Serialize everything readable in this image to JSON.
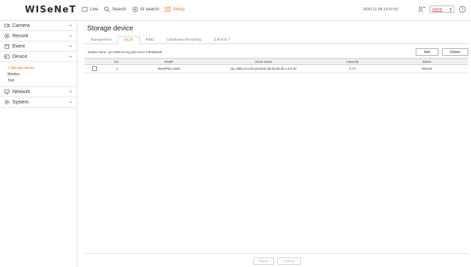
{
  "app": {
    "logo": "WISeNeT"
  },
  "topnav": {
    "items": [
      {
        "label": "Live",
        "icon": "live-icon",
        "active": false
      },
      {
        "label": "Search",
        "icon": "search-icon",
        "active": false
      },
      {
        "label": "AI search",
        "icon": "ai-search-icon",
        "active": false
      },
      {
        "label": "Setup",
        "icon": "setup-icon",
        "active": true
      }
    ],
    "datetime": "2020-11-04 13:37:50",
    "user": "admin",
    "accent": "#f37321"
  },
  "sidebar": {
    "menus": [
      {
        "label": "Camera",
        "icon": "camera-icon",
        "expanded": false
      },
      {
        "label": "Record",
        "icon": "record-icon",
        "expanded": false
      },
      {
        "label": "Event",
        "icon": "event-icon",
        "expanded": false
      },
      {
        "label": "Device",
        "icon": "device-icon",
        "expanded": true
      }
    ],
    "device_sub": [
      {
        "label": "> Storage device",
        "active": true
      },
      {
        "label": "Monitor",
        "active": false
      },
      {
        "label": "Text",
        "active": false
      }
    ],
    "menus_after": [
      {
        "label": "Network",
        "icon": "network-icon",
        "expanded": false
      },
      {
        "label": "System",
        "icon": "system-icon",
        "expanded": false
      }
    ]
  },
  "main": {
    "title": "Storage device",
    "tabs": [
      {
        "label": "Management",
        "active": false
      },
      {
        "label": "iSCSI",
        "active": true
      },
      {
        "label": "RAID",
        "active": false
      },
      {
        "label": "Distributed Recording",
        "active": false
      },
      {
        "label": "S.M.A.R.T",
        "active": false
      }
    ],
    "initiator": "· Initiator name : iqn.2005-03.org.open-iscsi:778066ba25",
    "buttons": {
      "add": "Add",
      "delete": "Delete"
    },
    "table": {
      "headers": [
        "",
        "No.",
        "Model",
        "iSCSI name",
        "Capacity",
        "Status"
      ],
      "rows": [
        {
          "no": "1",
          "model": "WavePlus 1648",
          "iscsi_name": "iqn.1992-12.com.promise:28.0a.05.35.1.0.0.20",
          "capacity": "0 / 0",
          "status": "Normal"
        }
      ]
    },
    "footer": {
      "apply": "Apply",
      "cancel": "Cancel"
    }
  }
}
